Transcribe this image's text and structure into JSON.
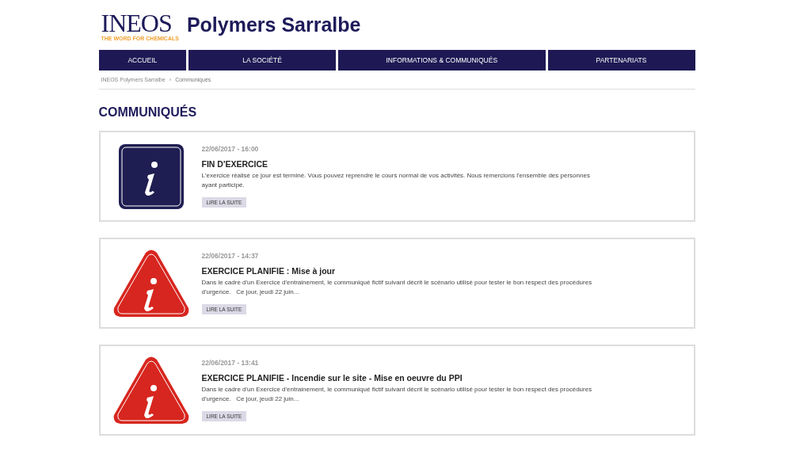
{
  "header": {
    "logo": {
      "wordmark": "INEOS",
      "tagline": "THE WORD FOR CHEMICALS"
    },
    "site_title": "Polymers Sarralbe"
  },
  "nav": [
    {
      "label": "ACCUEIL"
    },
    {
      "label": "LA SOCIÉTÉ"
    },
    {
      "label": "INFORMATIONS & COMMUNIQUÉS"
    },
    {
      "label": "PARTENARIATS"
    }
  ],
  "breadcrumb": [
    "INEOS Polymers Sarralbe",
    "Communiqués"
  ],
  "breadcrumb_separator": "›",
  "page_title": "COMMUNIQUÉS",
  "communiques": [
    {
      "kind": "info",
      "date": "22/06/2017 - 16:00",
      "title": "FIN D'EXERCICE",
      "excerpt": "L'exercice réalisé ce jour est terminé. Vous pouvez reprendre le cours normal de vos activités. Nous remercions l'ensemble des personnes ayant participé.",
      "button": "LIRE LA SUITE"
    },
    {
      "kind": "alert",
      "date": "22/06/2017 - 14:37",
      "title": "EXERCICE PLANIFIE : Mise à jour",
      "excerpt": "Dans le cadre d'un Exercice d'entrainement, le communiqué fictif suivant décrit le scénario utilisé pour tester le bon respect des procédures d'urgence.   Ce jour, jeudi 22 juin...",
      "button": "LIRE LA SUITE"
    },
    {
      "kind": "alert",
      "date": "22/06/2017 - 13:41",
      "title": "EXERCICE PLANIFIE - Incendie sur le site - Mise en oeuvre du PPI",
      "excerpt": "Dans le cadre d'un Exercice d'entrainement, le communiqué fictif suivant décrit le scénario utilisé pour tester le bon respect des procédures d'urgence.   Ce jour, jeudi 22 juin...",
      "button": "LIRE LA SUITE"
    }
  ]
}
